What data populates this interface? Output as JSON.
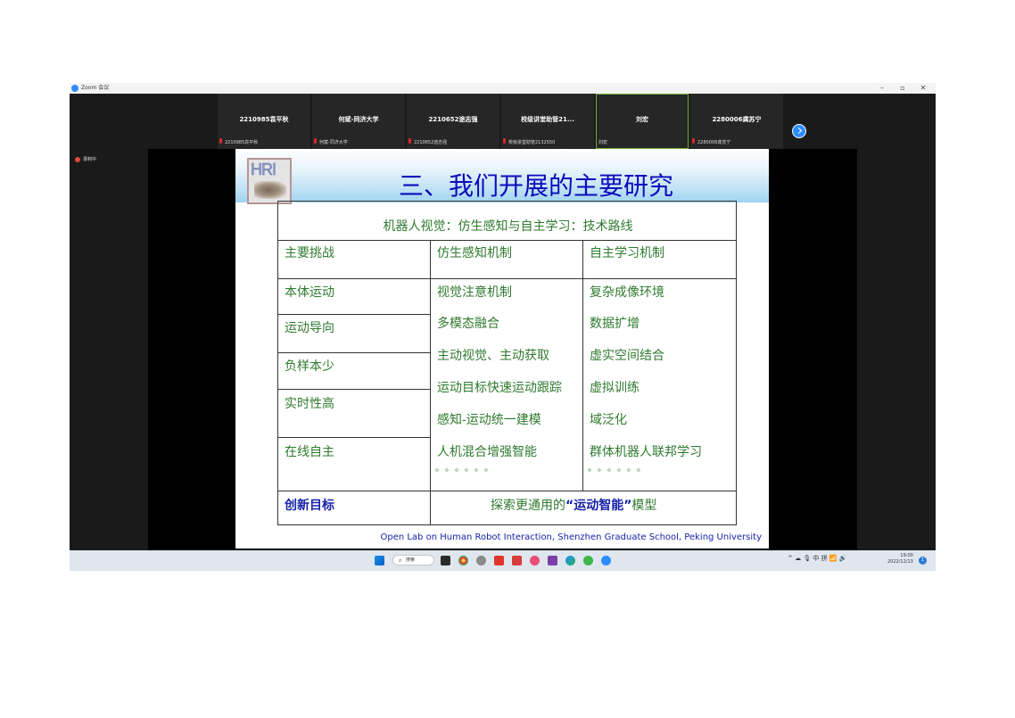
{
  "window": {
    "title": "Zoom 会议",
    "controls": {
      "minimize": "–",
      "maximize": "▫",
      "close": "✕"
    }
  },
  "participants": [
    {
      "name": "2210985袁平秋",
      "label": "2210985袁平秋",
      "muted": true
    },
    {
      "name": "何斌-同济大学",
      "label": "何斌-同济大学",
      "muted": true
    },
    {
      "name": "2210652途志强",
      "label": "2210652途志强",
      "muted": true
    },
    {
      "name": "校级讲堂助管21...",
      "label": "校级讲堂助管2132550",
      "muted": true
    },
    {
      "name": "刘宏",
      "label": "刘宏",
      "muted": false,
      "active": true
    },
    {
      "name": "2280006龚苏宁",
      "label": "2280006龚苏宁",
      "muted": true
    }
  ],
  "recording": {
    "label": "录制中"
  },
  "slide": {
    "title": "三、我们开展的主要研究",
    "logo_text": "HRI",
    "caption": "机器人视觉：仿生感知与自主学习：技术路线",
    "headers": [
      "主要挑战",
      "仿生感知机制",
      "自主学习机制"
    ],
    "col1": [
      "本体运动",
      "运动导向",
      "负样本少",
      "实时性高",
      "在线自主"
    ],
    "col2": [
      "视觉注意机制",
      "多模态融合",
      "主动视觉、主动获取",
      "运动目标快速运动跟踪",
      "感知-运动统一建模",
      "人机混合增强智能"
    ],
    "col3": [
      "复杂成像环境",
      "数据扩增",
      "虚实空间结合",
      "虚拟训练",
      "域泛化",
      "群体机器人联邦学习"
    ],
    "dots": "。。。。。。",
    "innovation_label": "创新目标",
    "innovation_prefix": "探索更通用的",
    "innovation_highlight": "“运动智能”",
    "innovation_suffix": "模型",
    "footer": "Open Lab on Human Robot Interaction, Shenzhen Graduate School, Peking University"
  },
  "taskbar": {
    "search_label": "搜索",
    "tray": "^  ☁  🎙  中  拼   📶 🔊",
    "time": "19:00",
    "date": "2022/12/13",
    "notification_count": "1"
  },
  "colors": {
    "title_blue": "#0b0bbb",
    "cell_green": "#2f7a2f",
    "zoom_blue": "#2d8cff",
    "muted_red": "#e02828"
  }
}
